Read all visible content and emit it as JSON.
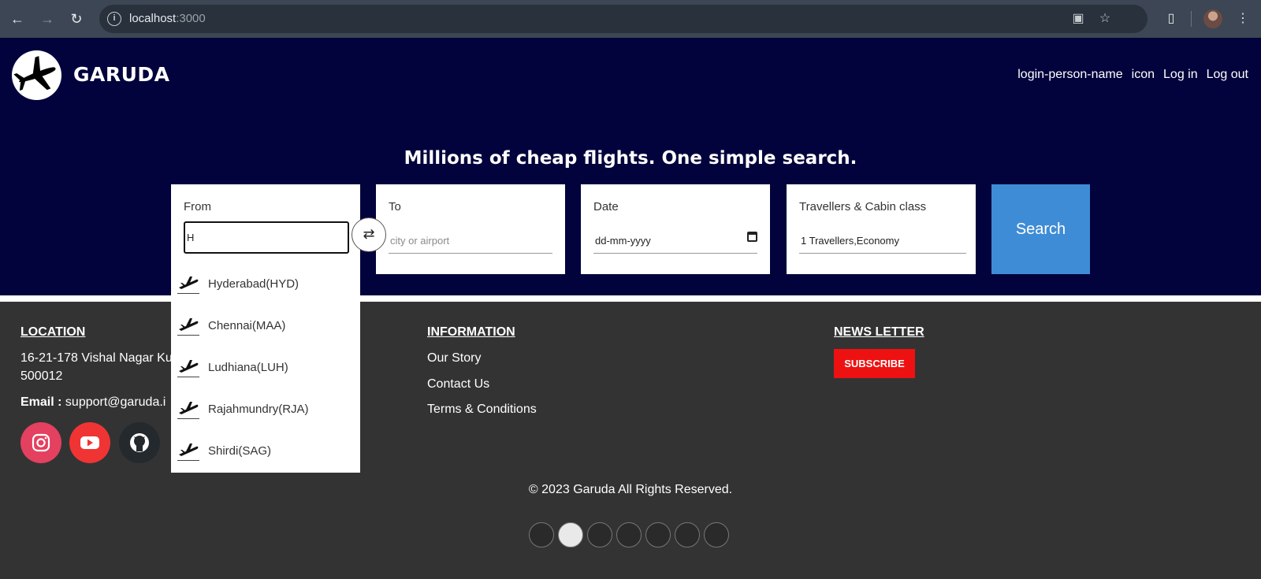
{
  "browser": {
    "url_host": "localhost",
    "url_port": ":3000"
  },
  "header": {
    "brand": "GARUDA",
    "nav": [
      "login-person-name",
      "icon",
      "Log in",
      "Log out"
    ]
  },
  "hero": {
    "tagline": "Millions of cheap flights. One simple search."
  },
  "search": {
    "from_label": "From",
    "from_value": "H",
    "to_label": "To",
    "to_placeholder": "city or airport",
    "date_label": "Date",
    "date_value": "dd-mm-yyyy",
    "travellers_label": "Travellers & Cabin class",
    "travellers_value": "1 Travellers,Economy",
    "search_button": "Search",
    "suggestions": [
      "Hyderabad(HYD)",
      "Chennai(MAA)",
      "Ludhiana(LUH)",
      "Rajahmundry(RJA)",
      "Shirdi(SAG)"
    ]
  },
  "footer": {
    "location_heading": "LOCATION",
    "address_line1": "16-21-178 Vishal Nagar Ku",
    "address_line2": "500012",
    "email_label": "Email :",
    "email_value": "support@garuda.i",
    "information_heading": "INFORMATION",
    "links": [
      "Our Story",
      "Contact Us",
      "Terms & Conditions"
    ],
    "newsletter_heading": "NEWS LETTER",
    "subscribe": "SUBSCRIBE",
    "copyright": "© 2023 Garuda All Rights Reserved."
  },
  "colors": {
    "hero_bg": "#02023c",
    "footer_bg": "#333333",
    "search_button": "#3f8cd6",
    "subscribe": "#ee1111",
    "instagram": "#e4405f",
    "youtube": "#f03434",
    "github": "#24292e"
  },
  "icons": [
    "back-arrow-icon",
    "forward-arrow-icon",
    "reload-icon",
    "info-icon",
    "install-icon",
    "star-icon",
    "extensions-icon",
    "menu-dots-icon",
    "plane-logo-icon",
    "swap-icon",
    "calendar-icon",
    "instagram-icon",
    "youtube-icon",
    "github-icon",
    "payment-icon"
  ]
}
